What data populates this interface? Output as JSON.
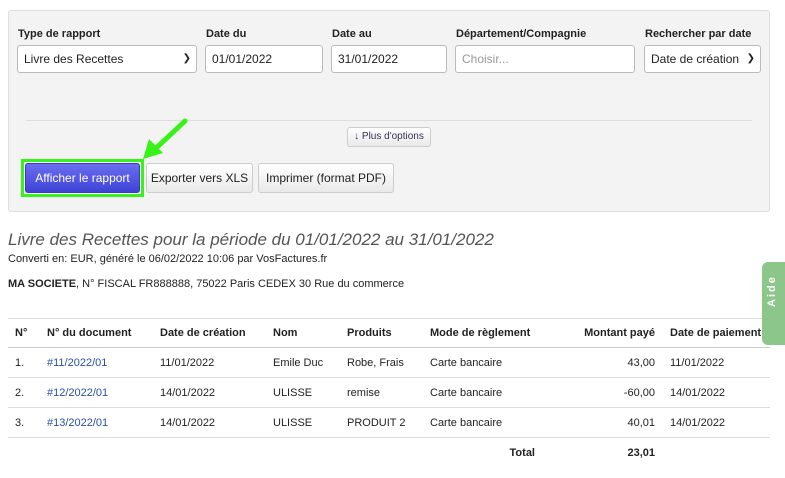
{
  "form": {
    "type_label": "Type de rapport",
    "type_value": "Livre des Recettes",
    "from_label": "Date du",
    "from_value": "01/01/2022",
    "to_label": "Date au",
    "to_value": "31/01/2022",
    "dept_label": "Département/Compagnie",
    "dept_placeholder": "Choisir...",
    "search_label": "Rechercher par date",
    "search_value": "Date de création",
    "more_options": "↓ Plus d'options",
    "show": "Afficher le rapport",
    "export": "Exporter vers XLS",
    "print": "Imprimer (format PDF)"
  },
  "report": {
    "title": "Livre des Recettes pour la période du 01/01/2022 au 31/01/2022",
    "subtitle": "Converti en: EUR, généré le 06/02/2022 10:06 par VosFactures.fr",
    "company": "MA SOCIETE",
    "company_rest": ", N° FISCAL FR888888, 75022 Paris CEDEX 30 Rue du commerce"
  },
  "table": {
    "headers": [
      "N°",
      "N° du document",
      "Date de création",
      "Nom",
      "Produits",
      "Mode de règlement",
      "Montant payé",
      "Date de paiement"
    ],
    "rows": [
      [
        "1.",
        "#11/2022/01",
        "11/01/2022",
        "Emile Duc",
        "Robe, Frais",
        "Carte bancaire",
        "43,00",
        "11/01/2022"
      ],
      [
        "2.",
        "#12/2022/01",
        "14/01/2022",
        "ULISSE",
        "remise",
        "Carte bancaire",
        "-60,00",
        "14/01/2022"
      ],
      [
        "3.",
        "#13/2022/01",
        "14/01/2022",
        "ULISSE",
        "PRODUIT 2",
        "Carte bancaire",
        "40,01",
        "14/01/2022"
      ]
    ],
    "total_label": "Total",
    "total_value": "23,01"
  },
  "aide": "Aide"
}
